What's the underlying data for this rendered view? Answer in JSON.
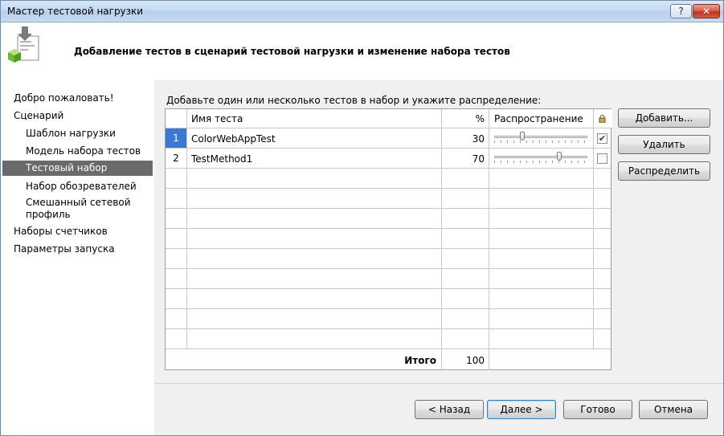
{
  "window": {
    "title": "Мастер тестовой нагрузки",
    "help_label": "?",
    "close_label": "✕"
  },
  "header": {
    "title": "Добавление тестов в сценарий тестовой нагрузки и изменение набора тестов"
  },
  "nav": {
    "items": [
      {
        "label": "Добро пожаловать!",
        "level": 0,
        "selected": false
      },
      {
        "label": "Сценарий",
        "level": 0,
        "selected": false
      },
      {
        "label": "Шаблон нагрузки",
        "level": 1,
        "selected": false
      },
      {
        "label": "Модель набора тестов",
        "level": 1,
        "selected": false
      },
      {
        "label": "Тестовый набор",
        "level": 1,
        "selected": true
      },
      {
        "label": "Набор обозревателей",
        "level": 1,
        "selected": false
      },
      {
        "label": "Смешанный сетевой профиль",
        "level": 1,
        "selected": false
      },
      {
        "label": "Наборы счетчиков",
        "level": 0,
        "selected": false
      },
      {
        "label": "Параметры запуска",
        "level": 0,
        "selected": false
      }
    ]
  },
  "content": {
    "instruction": "Добавьте один или несколько тестов в набор и укажите распределение:",
    "grid": {
      "columns": {
        "name": "Имя теста",
        "percent": "%",
        "distribution": "Распространение",
        "lock_icon": "lock-icon"
      },
      "rows": [
        {
          "num": "1",
          "name": "ColorWebAppTest",
          "percent": "30",
          "slider": 0.3,
          "locked": true
        },
        {
          "num": "2",
          "name": "TestMethod1",
          "percent": "70",
          "slider": 0.7,
          "locked": false
        }
      ],
      "empty_rows": 9,
      "total_label": "Итого",
      "total_value": "100"
    },
    "buttons": {
      "add": "Добавить...",
      "remove": "Удалить",
      "distribute": "Распределить"
    }
  },
  "footer": {
    "back": "< Назад",
    "next": "Далее >",
    "finish": "Готово",
    "cancel": "Отмена"
  },
  "colors": {
    "selection_blue": "#3a78d4",
    "nav_selected": "#6a6a6a",
    "checkmark": "#1b3f90"
  }
}
